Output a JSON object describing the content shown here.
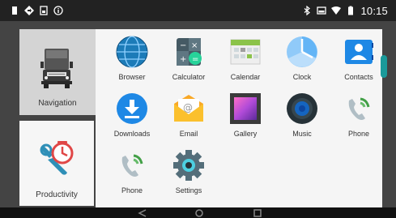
{
  "status_bar": {
    "left_icons": [
      "notification-icon",
      "navigation-arrow-icon",
      "sim-card-icon",
      "info-icon"
    ],
    "right_icons": [
      "bluetooth-icon",
      "cast-icon",
      "wifi-icon",
      "battery-icon"
    ],
    "time": "10:15"
  },
  "sidebar": {
    "categories": [
      {
        "label": "Navigation",
        "icon": "truck-icon"
      },
      {
        "label": "Productivity",
        "icon": "wrench-clock-icon"
      }
    ]
  },
  "apps": [
    {
      "label": "Browser",
      "icon": "globe-icon"
    },
    {
      "label": "Calculator",
      "icon": "calculator-icon"
    },
    {
      "label": "Calendar",
      "icon": "calendar-icon"
    },
    {
      "label": "Clock",
      "icon": "clock-icon"
    },
    {
      "label": "Contacts",
      "icon": "contacts-icon"
    },
    {
      "label": "Downloads",
      "icon": "download-icon"
    },
    {
      "label": "Email",
      "icon": "email-icon"
    },
    {
      "label": "Gallery",
      "icon": "gallery-icon"
    },
    {
      "label": "Music",
      "icon": "speaker-icon"
    },
    {
      "label": "Phone",
      "icon": "phone-icon"
    },
    {
      "label": "Phone",
      "icon": "phone-icon"
    },
    {
      "label": "Settings",
      "icon": "gear-icon"
    }
  ],
  "nav_bar": {
    "buttons": [
      "back-icon",
      "home-icon",
      "recents-icon"
    ]
  },
  "colors": {
    "accent": "#1a9a9a",
    "status_bar": "#222222",
    "app_grid_bg": "#f5f5f5"
  }
}
